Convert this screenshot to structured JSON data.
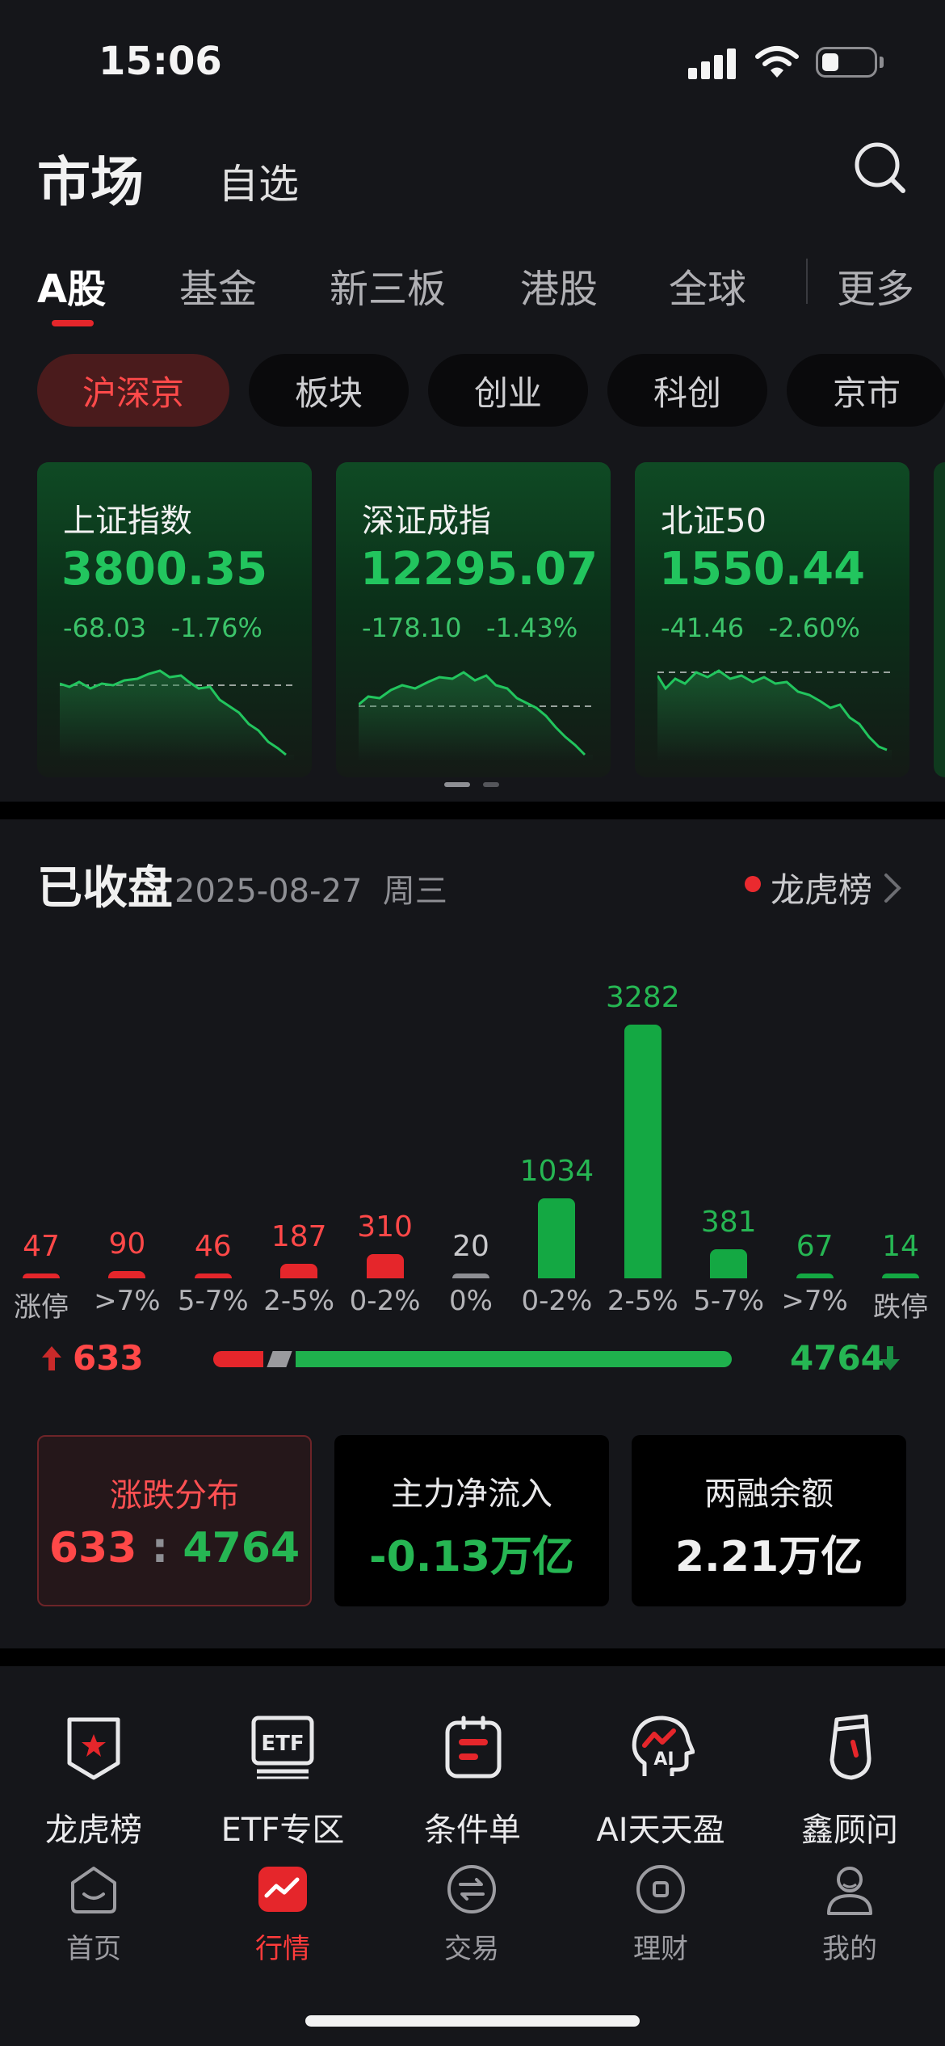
{
  "status": {
    "time": "15:06"
  },
  "header": {
    "title": "市场",
    "watchlist": "自选"
  },
  "category_tabs": [
    "A股",
    "基金",
    "新三板",
    "港股",
    "全球",
    "更多"
  ],
  "pills": [
    "沪深京",
    "板块",
    "创业",
    "科创",
    "京市"
  ],
  "indices": [
    {
      "name": "上证指数",
      "price": "3800.35",
      "change": "-68.03",
      "pct": "-1.76%"
    },
    {
      "name": "深证成指",
      "price": "12295.07",
      "change": "-178.10",
      "pct": "-1.43%"
    },
    {
      "name": "北证50",
      "price": "1550.44",
      "change": "-41.46",
      "pct": "-2.60%"
    }
  ],
  "market_close": {
    "status": "已收盘",
    "date": "2025-08-27",
    "weekday": "周三",
    "link": "龙虎榜"
  },
  "chart_data": {
    "type": "bar",
    "categories": [
      "涨停",
      ">7%",
      "5-7%",
      "2-5%",
      "0-2%",
      "0%",
      "0-2%",
      "2-5%",
      "5-7%",
      ">7%",
      "跌停"
    ],
    "values": [
      47,
      90,
      46,
      187,
      310,
      20,
      1034,
      3282,
      381,
      67,
      14
    ],
    "labels": [
      "47",
      "90",
      "46",
      "187",
      "310",
      "20",
      "1034",
      "3282",
      "381",
      "67",
      "14"
    ],
    "colors": [
      "#e5262b",
      "#e5262b",
      "#e5262b",
      "#e5262b",
      "#e5262b",
      "#8e8f94",
      "#14a843",
      "#14a843",
      "#14a843",
      "#14a843",
      "#14a843"
    ]
  },
  "breadth": {
    "up": "633",
    "down": "4764"
  },
  "stats": [
    {
      "label": "涨跌分布",
      "up": "633",
      "sep": ":",
      "down": "4764"
    },
    {
      "label": "主力净流入",
      "value": "-0.13万亿"
    },
    {
      "label": "两融余额",
      "value": "2.21万亿"
    }
  ],
  "shortcuts": [
    {
      "label": "龙虎榜",
      "icon": "shield-star-icon"
    },
    {
      "label": "ETF专区",
      "icon": "etf-icon"
    },
    {
      "label": "条件单",
      "icon": "clipboard-icon"
    },
    {
      "label": "AI天天盈",
      "icon": "ai-head-icon"
    },
    {
      "label": "鑫顾问",
      "icon": "pendant-icon"
    }
  ],
  "nav": [
    {
      "label": "首页",
      "icon": "home-icon"
    },
    {
      "label": "行情",
      "icon": "market-chart-icon"
    },
    {
      "label": "交易",
      "icon": "exchange-icon"
    },
    {
      "label": "理财",
      "icon": "wealth-icon"
    },
    {
      "label": "我的",
      "icon": "profile-icon"
    }
  ],
  "colors": {
    "up": "#e5262b",
    "down": "#14a843",
    "accent": "#e5262b",
    "background": "#15161a"
  }
}
